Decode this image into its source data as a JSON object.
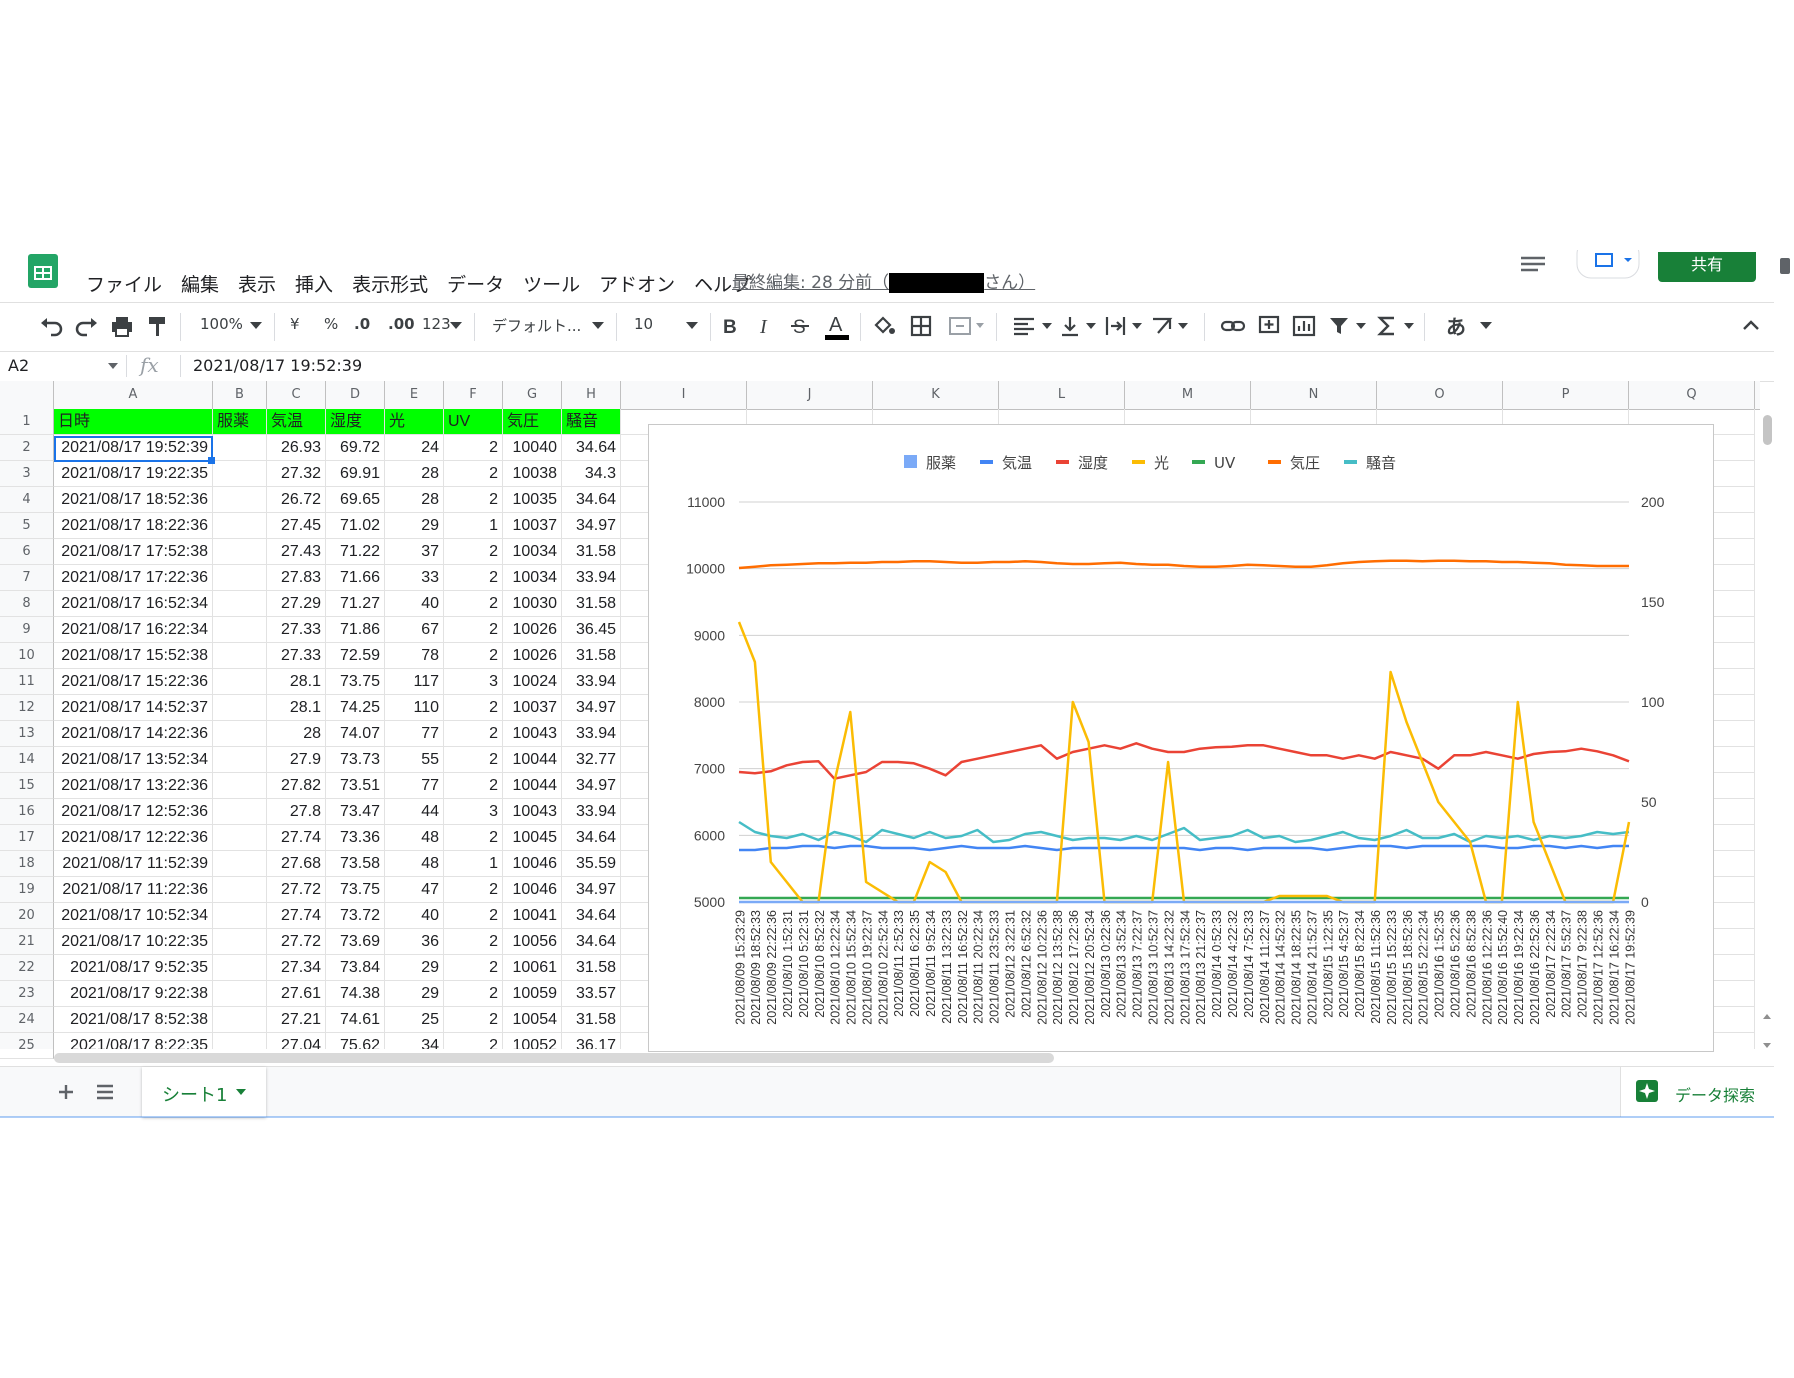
{
  "menu": [
    "ファイル",
    "編集",
    "表示",
    "挿入",
    "表示形式",
    "データ",
    "ツール",
    "アドオン",
    "ヘルプ"
  ],
  "last_edit": {
    "prefix": "最終編集: 28 分前（",
    "suffix": "さん）"
  },
  "share_label": "共有",
  "toolbar": {
    "zoom": "100%",
    "currency": "¥",
    "percent": "%",
    "dec_less": ".0",
    "dec_more": ".00",
    "format_more": "123",
    "font": "デフォルト...",
    "font_size": "10",
    "input_mode": "あ"
  },
  "formula": {
    "namebox": "A2",
    "fx": "fx",
    "value": "2021/08/17 19:52:39"
  },
  "columns": [
    "A",
    "B",
    "C",
    "D",
    "E",
    "F",
    "G",
    "H",
    "I",
    "J",
    "K",
    "L",
    "M",
    "N",
    "O",
    "P",
    "Q"
  ],
  "table": {
    "headers": [
      "日時",
      "服薬",
      "気温",
      "湿度",
      "光",
      "UV",
      "気圧",
      "騒音"
    ],
    "rows": [
      [
        "2021/08/17 19:52:39",
        "",
        "26.93",
        "69.72",
        "24",
        "2",
        "10040",
        "34.64"
      ],
      [
        "2021/08/17 19:22:35",
        "",
        "27.32",
        "69.91",
        "28",
        "2",
        "10038",
        "34.3"
      ],
      [
        "2021/08/17 18:52:36",
        "",
        "26.72",
        "69.65",
        "28",
        "2",
        "10035",
        "34.64"
      ],
      [
        "2021/08/17 18:22:36",
        "",
        "27.45",
        "71.02",
        "29",
        "1",
        "10037",
        "34.97"
      ],
      [
        "2021/08/17 17:52:38",
        "",
        "27.43",
        "71.22",
        "37",
        "2",
        "10034",
        "31.58"
      ],
      [
        "2021/08/17 17:22:36",
        "",
        "27.83",
        "71.66",
        "33",
        "2",
        "10034",
        "33.94"
      ],
      [
        "2021/08/17 16:52:34",
        "",
        "27.29",
        "71.27",
        "40",
        "2",
        "10030",
        "31.58"
      ],
      [
        "2021/08/17 16:22:34",
        "",
        "27.33",
        "71.86",
        "67",
        "2",
        "10026",
        "36.45"
      ],
      [
        "2021/08/17 15:52:38",
        "",
        "27.33",
        "72.59",
        "78",
        "2",
        "10026",
        "31.58"
      ],
      [
        "2021/08/17 15:22:36",
        "",
        "28.1",
        "73.75",
        "117",
        "3",
        "10024",
        "33.94"
      ],
      [
        "2021/08/17 14:52:37",
        "",
        "28.1",
        "74.25",
        "110",
        "2",
        "10037",
        "34.97"
      ],
      [
        "2021/08/17 14:22:36",
        "",
        "28",
        "74.07",
        "77",
        "2",
        "10043",
        "33.94"
      ],
      [
        "2021/08/17 13:52:34",
        "",
        "27.9",
        "73.73",
        "55",
        "2",
        "10044",
        "32.77"
      ],
      [
        "2021/08/17 13:22:36",
        "",
        "27.82",
        "73.51",
        "77",
        "2",
        "10044",
        "34.97"
      ],
      [
        "2021/08/17 12:52:36",
        "",
        "27.8",
        "73.47",
        "44",
        "3",
        "10043",
        "33.94"
      ],
      [
        "2021/08/17 12:22:36",
        "",
        "27.74",
        "73.36",
        "48",
        "2",
        "10045",
        "34.64"
      ],
      [
        "2021/08/17 11:52:39",
        "",
        "27.68",
        "73.58",
        "48",
        "1",
        "10046",
        "35.59"
      ],
      [
        "2021/08/17 11:22:36",
        "",
        "27.72",
        "73.75",
        "47",
        "2",
        "10046",
        "34.97"
      ],
      [
        "2021/08/17 10:52:34",
        "",
        "27.74",
        "73.72",
        "40",
        "2",
        "10041",
        "34.64"
      ],
      [
        "2021/08/17 10:22:35",
        "",
        "27.72",
        "73.69",
        "36",
        "2",
        "10056",
        "34.64"
      ],
      [
        "2021/08/17 9:52:35",
        "",
        "27.34",
        "73.84",
        "29",
        "2",
        "10061",
        "31.58"
      ],
      [
        "2021/08/17 9:22:38",
        "",
        "27.61",
        "74.38",
        "29",
        "2",
        "10059",
        "33.57"
      ],
      [
        "2021/08/17 8:52:38",
        "",
        "27.21",
        "74.61",
        "25",
        "2",
        "10054",
        "31.58"
      ],
      [
        "2021/08/17 8:22:35",
        "",
        "27.04",
        "75.62",
        "34",
        "2",
        "10052",
        "36.17"
      ]
    ]
  },
  "chart_data": {
    "type": "line",
    "legend_position": "top",
    "legend": [
      {
        "name": "服薬",
        "color": "#7baaf7",
        "shape": "square"
      },
      {
        "name": "気温",
        "color": "#4285f4",
        "shape": "line"
      },
      {
        "name": "湿度",
        "color": "#ea4335",
        "shape": "line"
      },
      {
        "name": "光",
        "color": "#fbbc04",
        "shape": "line"
      },
      {
        "name": "UV",
        "color": "#34a853",
        "shape": "line"
      },
      {
        "name": "気圧",
        "color": "#ff6d01",
        "shape": "line"
      },
      {
        "name": "騒音",
        "color": "#46bdc6",
        "shape": "line"
      }
    ],
    "y_left": {
      "min": 5000,
      "max": 11000,
      "ticks": [
        "5000",
        "6000",
        "7000",
        "8000",
        "9000",
        "10000",
        "11000"
      ]
    },
    "y_right": {
      "min": 0,
      "max": 200,
      "ticks": [
        "0",
        "50",
        "100",
        "150",
        "200"
      ]
    },
    "x_labels": [
      "2021/08/09 15:23:29",
      "2021/08/09 18:52:33",
      "2021/08/09 22:22:36",
      "2021/08/10 1:52:31",
      "2021/08/10 5:22:31",
      "2021/08/10 8:52:32",
      "2021/08/10 12:22:34",
      "2021/08/10 15:52:34",
      "2021/08/10 19:22:37",
      "2021/08/10 22:52:34",
      "2021/08/11 2:52:33",
      "2021/08/11 6:22:35",
      "2021/08/11 9:52:34",
      "2021/08/11 13:22:33",
      "2021/08/11 16:52:32",
      "2021/08/11 20:22:34",
      "2021/08/11 23:52:33",
      "2021/08/12 3:22:31",
      "2021/08/12 6:52:32",
      "2021/08/12 10:22:36",
      "2021/08/12 13:52:38",
      "2021/08/12 17:22:36",
      "2021/08/12 20:52:34",
      "2021/08/13 0:22:36",
      "2021/08/13 3:52:34",
      "2021/08/13 7:22:37",
      "2021/08/13 10:52:37",
      "2021/08/13 14:22:32",
      "2021/08/13 17:52:34",
      "2021/08/13 21:22:37",
      "2021/08/14 0:52:33",
      "2021/08/14 4:22:32",
      "2021/08/14 7:52:33",
      "2021/08/14 11:22:37",
      "2021/08/14 14:52:32",
      "2021/08/14 18:22:35",
      "2021/08/14 21:52:37",
      "2021/08/15 1:22:35",
      "2021/08/15 4:52:37",
      "2021/08/15 8:22:34",
      "2021/08/15 11:52:36",
      "2021/08/15 15:22:33",
      "2021/08/15 18:52:36",
      "2021/08/15 22:22:34",
      "2021/08/16 1:52:35",
      "2021/08/16 5:22:36",
      "2021/08/16 8:52:38",
      "2021/08/16 12:22:36",
      "2021/08/16 15:52:40",
      "2021/08/16 19:22:34",
      "2021/08/16 22:52:36",
      "2021/08/17 2:22:34",
      "2021/08/17 5:52:37",
      "2021/08/17 9:22:38",
      "2021/08/17 12:52:36",
      "2021/08/17 16:22:34",
      "2021/08/17 19:52:39"
    ],
    "series": [
      {
        "name": "気圧",
        "axis": "left",
        "values": [
          10010,
          10030,
          10050,
          10060,
          10070,
          10080,
          10080,
          10090,
          10090,
          10100,
          10100,
          10110,
          10110,
          10100,
          10090,
          10090,
          10100,
          10100,
          10110,
          10100,
          10080,
          10070,
          10070,
          10080,
          10090,
          10070,
          10060,
          10060,
          10040,
          10030,
          10030,
          10040,
          10060,
          10050,
          10040,
          10030,
          10030,
          10050,
          10080,
          10100,
          10110,
          10120,
          10120,
          10110,
          10120,
          10120,
          10110,
          10110,
          10100,
          10100,
          10090,
          10080,
          10060,
          10050,
          10040,
          10040,
          10040
        ]
      },
      {
        "name": "湿度",
        "axis": "left",
        "values": [
          6950,
          6930,
          6960,
          7050,
          7100,
          7110,
          6850,
          6900,
          6950,
          7100,
          7100,
          7080,
          7000,
          6900,
          7100,
          7150,
          7200,
          7250,
          7300,
          7350,
          7150,
          7250,
          7300,
          7350,
          7300,
          7380,
          7300,
          7250,
          7250,
          7300,
          7320,
          7330,
          7350,
          7350,
          7300,
          7250,
          7200,
          7200,
          7150,
          7200,
          7150,
          7250,
          7200,
          7150,
          7000,
          7200,
          7200,
          7250,
          7200,
          7150,
          7220,
          7250,
          7260,
          7300,
          7260,
          7200,
          7110
        ]
      },
      {
        "name": "騒音",
        "axis": "right",
        "values": [
          40,
          35,
          33,
          32,
          34,
          31,
          35,
          33,
          30,
          36,
          34,
          32,
          35,
          32,
          33,
          36,
          30,
          31,
          34,
          35,
          33,
          31,
          32,
          32,
          31,
          33,
          31,
          34,
          37,
          31,
          32,
          33,
          36,
          32,
          33,
          30,
          31,
          33,
          35,
          32,
          31,
          33,
          36,
          32,
          32,
          34,
          30,
          33,
          32,
          33,
          31,
          33,
          32,
          33,
          35,
          34,
          35
        ]
      },
      {
        "name": "気温",
        "axis": "right",
        "values": [
          26,
          26,
          27,
          27,
          28,
          28,
          27,
          28,
          28,
          27,
          27,
          27,
          26,
          27,
          28,
          27,
          27,
          27,
          28,
          27,
          26,
          27,
          27,
          27,
          27,
          27,
          27,
          27,
          27,
          26,
          27,
          27,
          26,
          27,
          27,
          27,
          27,
          26,
          27,
          28,
          28,
          28,
          27,
          28,
          28,
          28,
          28,
          28,
          27,
          27,
          28,
          28,
          27,
          28,
          27,
          28,
          28
        ]
      },
      {
        "name": "光",
        "axis": "right",
        "values": [
          140,
          120,
          20,
          10,
          0,
          0,
          60,
          95,
          10,
          5,
          0,
          0,
          20,
          15,
          0,
          0,
          0,
          0,
          0,
          0,
          0,
          100,
          80,
          0,
          0,
          0,
          0,
          70,
          0,
          0,
          0,
          0,
          0,
          0,
          3,
          3,
          3,
          3,
          0,
          0,
          0,
          115,
          90,
          70,
          50,
          40,
          30,
          0,
          0,
          100,
          40,
          20,
          0,
          0,
          0,
          0,
          40
        ]
      },
      {
        "name": "UV",
        "axis": "right",
        "values": [
          2,
          2,
          2,
          2,
          2,
          2,
          2,
          2,
          2,
          2,
          2,
          2,
          2,
          2,
          2,
          2,
          2,
          2,
          2,
          2,
          2,
          2,
          2,
          2,
          2,
          2,
          2,
          2,
          2,
          2,
          2,
          2,
          2,
          2,
          2,
          2,
          2,
          2,
          2,
          2,
          2,
          2,
          2,
          2,
          2,
          2,
          2,
          2,
          2,
          2,
          2,
          2,
          2,
          2,
          2,
          2,
          2
        ]
      },
      {
        "name": "服薬",
        "axis": "right",
        "values": [
          0,
          0,
          0,
          0,
          0,
          0,
          0,
          0,
          0,
          0,
          0,
          0,
          0,
          0,
          0,
          0,
          0,
          0,
          0,
          0,
          0,
          0,
          0,
          0,
          0,
          0,
          0,
          0,
          0,
          0,
          0,
          0,
          0,
          0,
          0,
          0,
          0,
          0,
          0,
          0,
          0,
          0,
          0,
          0,
          0,
          0,
          0,
          0,
          0,
          0,
          0,
          0,
          0,
          0,
          0,
          0,
          0
        ]
      }
    ]
  },
  "sheet_tab": "シート1",
  "explore_label": "データ探索"
}
